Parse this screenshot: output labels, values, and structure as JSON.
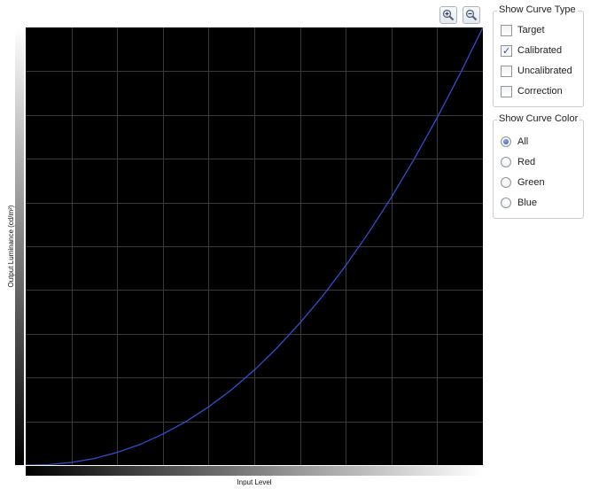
{
  "chart": {
    "y_axis_label": "Output Luminance (cd/m²)",
    "x_axis_label": "Input Level",
    "background": "#000000",
    "grid_color": "#3a3a3a",
    "curve_color": "#2f4fd0"
  },
  "chart_data": {
    "type": "line",
    "ylabel": "Output Luminance (cd/m²)",
    "xlabel": "Input Level",
    "xlim": [
      0,
      1
    ],
    "ylim": [
      0,
      1
    ],
    "grid": true,
    "grid_divisions_x": 10,
    "grid_divisions_y": 10,
    "series": [
      {
        "values_x": [
          0,
          0.05,
          0.1,
          0.15,
          0.2,
          0.25,
          0.3,
          0.35,
          0.4,
          0.45,
          0.5,
          0.55,
          0.6,
          0.65,
          0.7,
          0.75,
          0.8,
          0.85,
          0.9,
          0.95,
          1.0
        ],
        "values_y": [
          0,
          0.001,
          0.006,
          0.015,
          0.029,
          0.047,
          0.071,
          0.099,
          0.133,
          0.172,
          0.217,
          0.268,
          0.325,
          0.387,
          0.456,
          0.531,
          0.612,
          0.7,
          0.794,
          0.894,
          1.0
        ]
      }
    ]
  },
  "zoom": {
    "in_icon": "zoom-in-icon",
    "out_icon": "zoom-out-icon"
  },
  "curve_type": {
    "title": "Show Curve Type",
    "options": [
      {
        "label": "Target",
        "checked": false
      },
      {
        "label": "Calibrated",
        "checked": true
      },
      {
        "label": "Uncalibrated",
        "checked": false
      },
      {
        "label": "Correction",
        "checked": false
      }
    ]
  },
  "curve_color": {
    "title": "Show Curve Color",
    "selected": "All",
    "options": [
      {
        "label": "All"
      },
      {
        "label": "Red"
      },
      {
        "label": "Green"
      },
      {
        "label": "Blue"
      }
    ]
  }
}
